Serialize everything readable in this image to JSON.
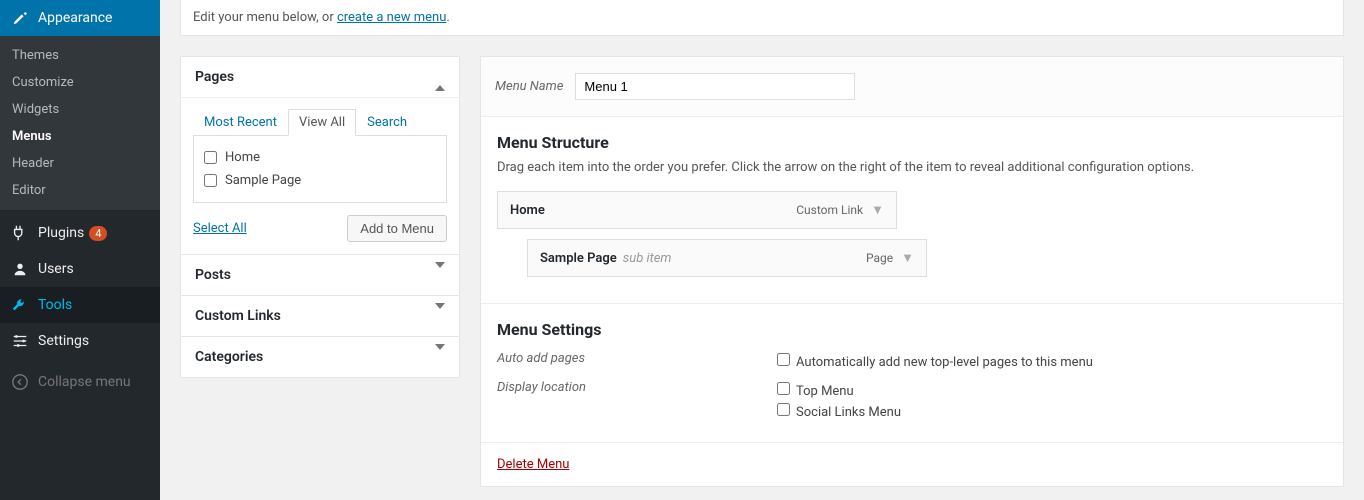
{
  "sidebar": {
    "appearance": {
      "label": "Appearance",
      "items": [
        "Themes",
        "Customize",
        "Widgets",
        "Menus",
        "Header",
        "Editor"
      ]
    },
    "plugins": {
      "label": "Plugins",
      "badge": "4"
    },
    "users": {
      "label": "Users"
    },
    "tools": {
      "label": "Tools"
    },
    "settings": {
      "label": "Settings"
    },
    "collapse": {
      "label": "Collapse menu"
    }
  },
  "intro": {
    "text": "Edit your menu below, or ",
    "link": "create a new menu",
    "after": "."
  },
  "accordion": {
    "pages": {
      "title": "Pages",
      "tabs": [
        "Most Recent",
        "View All",
        "Search"
      ],
      "items": [
        "Home",
        "Sample Page"
      ],
      "select_all": "Select All",
      "add_btn": "Add to Menu"
    },
    "posts": {
      "title": "Posts"
    },
    "custom": {
      "title": "Custom Links"
    },
    "cats": {
      "title": "Categories"
    }
  },
  "menu": {
    "name_label": "Menu Name",
    "name_value": "Menu 1",
    "structure": {
      "title": "Menu Structure",
      "desc": "Drag each item into the order you prefer. Click the arrow on the right of the item to reveal additional configuration options.",
      "items": [
        {
          "title": "Home",
          "type": "Custom Link",
          "sub": false
        },
        {
          "title": "Sample Page",
          "subtext": "sub item",
          "type": "Page",
          "sub": true
        }
      ]
    },
    "settings": {
      "title": "Menu Settings",
      "auto_label": "Auto add pages",
      "auto_opt": "Automatically add new top-level pages to this menu",
      "loc_label": "Display location",
      "loc_opts": [
        "Top Menu",
        "Social Links Menu"
      ]
    },
    "delete": "Delete Menu"
  }
}
